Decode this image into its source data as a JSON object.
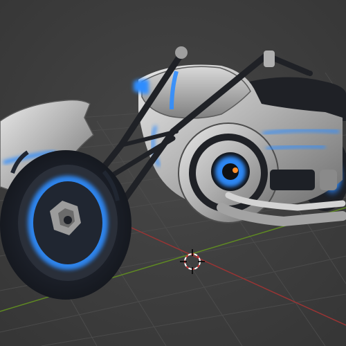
{
  "viewport": {
    "background_color": "#3d3d3d",
    "grid_color": "#4a4a4a",
    "x_axis_color": "#9a3434",
    "y_axis_color": "#5f8a22",
    "cursor_icon": "3d-cursor-icon",
    "object_icon": "motorcycle-model",
    "accent_glow_color": "#2f8dff",
    "body_color": "#b9b9b9",
    "tire_color": "#1a1d22"
  }
}
